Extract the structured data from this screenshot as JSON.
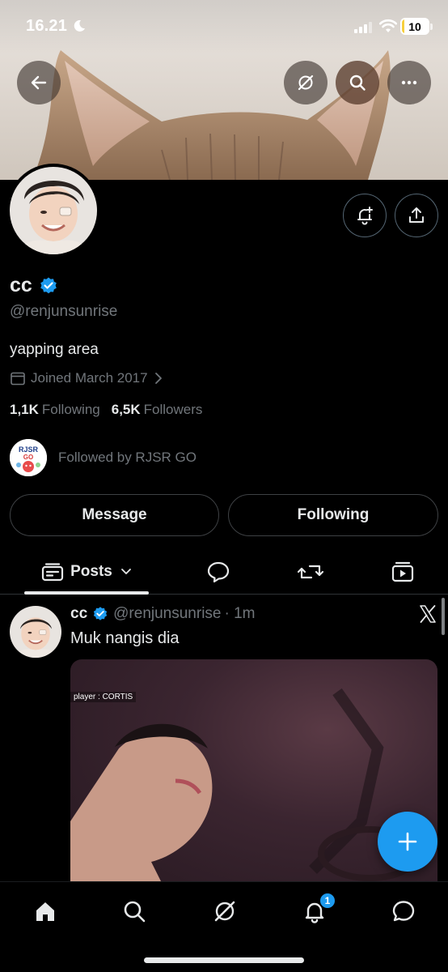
{
  "status_bar": {
    "time": "16.21",
    "battery": "10",
    "battery_level_percent": 10
  },
  "header": {
    "icons": [
      "back-arrow-icon",
      "grok-icon",
      "search-icon",
      "more-icon"
    ]
  },
  "profile": {
    "display_name": "cc",
    "handle": "@renjunsunrise",
    "bio": "yapping area",
    "joined": "Joined March 2017",
    "following_count": "1,1K",
    "following_label": "Following",
    "followers_count": "6,5K",
    "followers_label": "Followers",
    "followed_by": "Followed by RJSR GO",
    "followed_by_avatar_text": "RJSR GO"
  },
  "actions": {
    "message": "Message",
    "following": "Following"
  },
  "tabs": {
    "posts": "Posts"
  },
  "post": {
    "name": "cc",
    "handle": "@renjunsunrise",
    "time": "· 1m",
    "text": "Muk nangis dia",
    "media_overlay": "player : CORTIS"
  },
  "bottom_nav": {
    "notifications_badge": "1"
  },
  "colors": {
    "accent": "#1d9bf0",
    "background": "#000000",
    "secondary_text": "#71767b",
    "primary_text": "#e7e9ea"
  }
}
